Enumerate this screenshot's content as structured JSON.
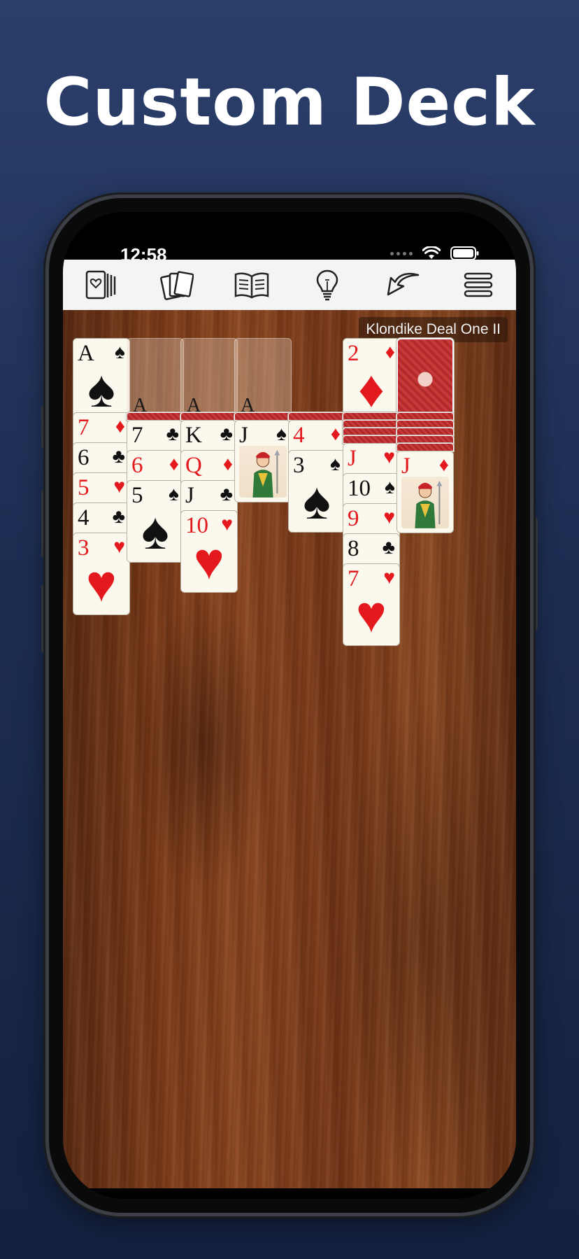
{
  "headline": "Custom Deck",
  "status": {
    "time": "12:58"
  },
  "toolbar": {
    "items": [
      {
        "icon": "cards-hearts-icon"
      },
      {
        "icon": "stacked-cards-icon"
      },
      {
        "icon": "book-icon"
      },
      {
        "icon": "lightbulb-icon"
      },
      {
        "icon": "undo-arrow-icon"
      },
      {
        "icon": "menu-icon"
      }
    ]
  },
  "game": {
    "deal_label": "Klondike Deal One II",
    "foundations": [
      {
        "rank": "A",
        "suit": "♠",
        "color": "black"
      },
      {
        "placeholder": "A"
      },
      {
        "placeholder": "A"
      },
      {
        "placeholder": "A"
      }
    ],
    "waste": {
      "rank": "2",
      "suit": "♦",
      "color": "red"
    },
    "tableau": [
      {
        "hidden": 0,
        "cards": [
          {
            "rank": "7",
            "suit": "♦",
            "color": "red"
          },
          {
            "rank": "6",
            "suit": "♣",
            "color": "black"
          },
          {
            "rank": "5",
            "suit": "♥",
            "color": "red"
          },
          {
            "rank": "4",
            "suit": "♣",
            "color": "black"
          },
          {
            "rank": "3",
            "suit": "♥",
            "color": "red"
          }
        ]
      },
      {
        "hidden": 1,
        "cards": [
          {
            "rank": "7",
            "suit": "♣",
            "color": "black"
          },
          {
            "rank": "6",
            "suit": "♦",
            "color": "red"
          },
          {
            "rank": "5",
            "suit": "♠",
            "color": "black"
          }
        ]
      },
      {
        "hidden": 1,
        "cards": [
          {
            "rank": "K",
            "suit": "♣",
            "color": "black"
          },
          {
            "rank": "Q",
            "suit": "♦",
            "color": "red"
          },
          {
            "rank": "J",
            "suit": "♣",
            "color": "black"
          },
          {
            "rank": "10",
            "suit": "♥",
            "color": "red"
          }
        ]
      },
      {
        "hidden": 1,
        "cards": [
          {
            "rank": "J",
            "suit": "♠",
            "color": "black",
            "face": true
          }
        ]
      },
      {
        "hidden": 1,
        "cards": [
          {
            "rank": "4",
            "suit": "♦",
            "color": "red"
          },
          {
            "rank": "3",
            "suit": "♠",
            "color": "black"
          }
        ]
      },
      {
        "hidden": 4,
        "cards": [
          {
            "rank": "J",
            "suit": "♥",
            "color": "red"
          },
          {
            "rank": "10",
            "suit": "♠",
            "color": "black"
          },
          {
            "rank": "9",
            "suit": "♥",
            "color": "red"
          },
          {
            "rank": "8",
            "suit": "♣",
            "color": "black"
          },
          {
            "rank": "7",
            "suit": "♥",
            "color": "red"
          }
        ]
      },
      {
        "hidden": 5,
        "cards": [
          {
            "rank": "J",
            "suit": "♦",
            "color": "red",
            "face": true
          }
        ]
      }
    ]
  }
}
